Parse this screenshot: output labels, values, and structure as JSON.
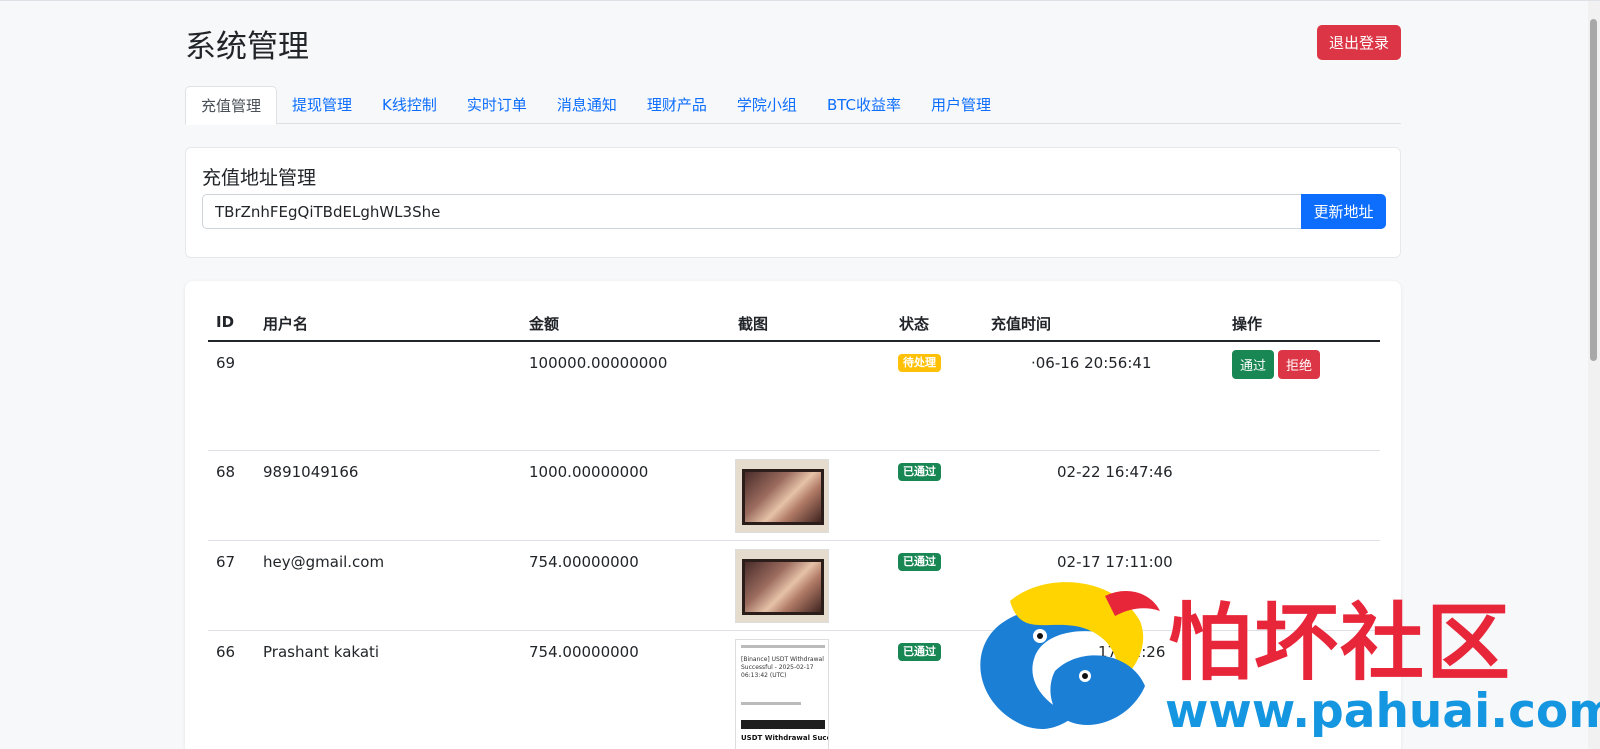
{
  "header": {
    "title": "系统管理",
    "logout_label": "退出登录"
  },
  "tabs": [
    {
      "label": "充值管理",
      "active": true
    },
    {
      "label": "提现管理"
    },
    {
      "label": "K线控制"
    },
    {
      "label": "实时订单"
    },
    {
      "label": "消息通知"
    },
    {
      "label": "理财产品"
    },
    {
      "label": "学院小组"
    },
    {
      "label": "BTC收益率"
    },
    {
      "label": "用户管理"
    }
  ],
  "address_card": {
    "title": "充值地址管理",
    "address_value": "TBrZnhFEgQiTBdELghWL3She",
    "update_label": "更新地址"
  },
  "table": {
    "headers": {
      "id": "ID",
      "username": "用户名",
      "amount": "金额",
      "screenshot": "截图",
      "status": "状态",
      "time": "充值时间",
      "actions": "操作"
    },
    "rows": [
      {
        "id": "69",
        "username": "",
        "amount": "100000.00000000",
        "status": "待处理",
        "time": "·06-16 20:56:41",
        "pass_label": "通过",
        "reject_label": "拒绝"
      },
      {
        "id": "68",
        "username": "9891049166",
        "amount": "1000.00000000",
        "status": "已通过",
        "time": "02-22 16:47:46"
      },
      {
        "id": "67",
        "username": "hey@gmail.com",
        "amount": "754.00000000",
        "status": "已通过",
        "time": "02-17 17:11:00"
      },
      {
        "id": "66",
        "username": "Prashant kakati",
        "amount": "754.00000000",
        "status": "已通过",
        "time": "17:22:26"
      }
    ],
    "receipt": {
      "text": "[Binance] USDT Withdrawal Successful - 2025-02-17 06:13:42 (UTC)",
      "title": "USDT Withdrawal Successful"
    }
  },
  "watermark": {
    "text": "怕坏社区",
    "url": "www.pahuai.com"
  },
  "colors": {
    "primary": "#0d6efd",
    "danger": "#dc3545",
    "success": "#198754",
    "warning": "#ffc107"
  }
}
